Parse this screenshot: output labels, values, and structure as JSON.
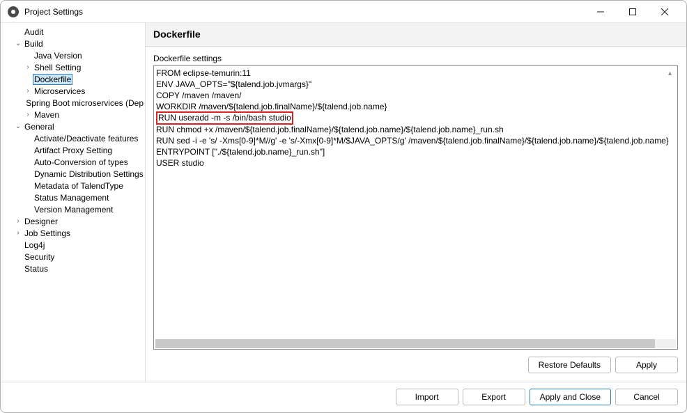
{
  "window": {
    "title": "Project Settings"
  },
  "sidebar": {
    "items": [
      {
        "label": "Audit",
        "level": 1,
        "exp": ""
      },
      {
        "label": "Build",
        "level": 1,
        "exp": "v"
      },
      {
        "label": "Java Version",
        "level": 2,
        "exp": ""
      },
      {
        "label": "Shell Setting",
        "level": 2,
        "exp": ">"
      },
      {
        "label": "Dockerfile",
        "level": 2,
        "exp": "",
        "selected": true
      },
      {
        "label": "Microservices",
        "level": 2,
        "exp": ">"
      },
      {
        "label": "Spring Boot microservices (Dep",
        "level": 2,
        "exp": ""
      },
      {
        "label": "Maven",
        "level": 2,
        "exp": ">"
      },
      {
        "label": "General",
        "level": 1,
        "exp": "v"
      },
      {
        "label": "Activate/Deactivate features",
        "level": 2,
        "exp": ""
      },
      {
        "label": "Artifact Proxy Setting",
        "level": 2,
        "exp": ""
      },
      {
        "label": "Auto-Conversion of types",
        "level": 2,
        "exp": ""
      },
      {
        "label": "Dynamic Distribution Settings",
        "level": 2,
        "exp": ""
      },
      {
        "label": "Metadata of TalendType",
        "level": 2,
        "exp": ""
      },
      {
        "label": "Status Management",
        "level": 2,
        "exp": ""
      },
      {
        "label": "Version Management",
        "level": 2,
        "exp": ""
      },
      {
        "label": "Designer",
        "level": 1,
        "exp": ">"
      },
      {
        "label": "Job Settings",
        "level": 1,
        "exp": ">"
      },
      {
        "label": "Log4j",
        "level": 1,
        "exp": ""
      },
      {
        "label": "Security",
        "level": 1,
        "exp": ""
      },
      {
        "label": "Status",
        "level": 1,
        "exp": ""
      }
    ]
  },
  "content": {
    "heading": "Dockerfile",
    "settings_label": "Dockerfile settings",
    "lines": [
      "FROM eclipse-temurin:11",
      "ENV JAVA_OPTS=\"${talend.job.jvmargs}\"",
      "COPY /maven /maven/",
      "WORKDIR /maven/${talend.job.finalName}/${talend.job.name}",
      "RUN useradd -m -s /bin/bash studio",
      "RUN chmod +x /maven/${talend.job.finalName}/${talend.job.name}/${talend.job.name}_run.sh",
      "RUN sed -i -e 's/ -Xms[0-9]*M//g' -e 's/-Xmx[0-9]*M/$JAVA_OPTS/g' /maven/${talend.job.finalName}/${talend.job.name}/${talend.job.name}",
      "ENTRYPOINT [\"./${talend.job.name}_run.sh\"]",
      "USER studio"
    ],
    "highlighted_line_index": 4
  },
  "panel_buttons": {
    "restore": "Restore Defaults",
    "apply": "Apply"
  },
  "footer_buttons": {
    "import": "Import",
    "export": "Export",
    "apply_close": "Apply and Close",
    "cancel": "Cancel"
  }
}
